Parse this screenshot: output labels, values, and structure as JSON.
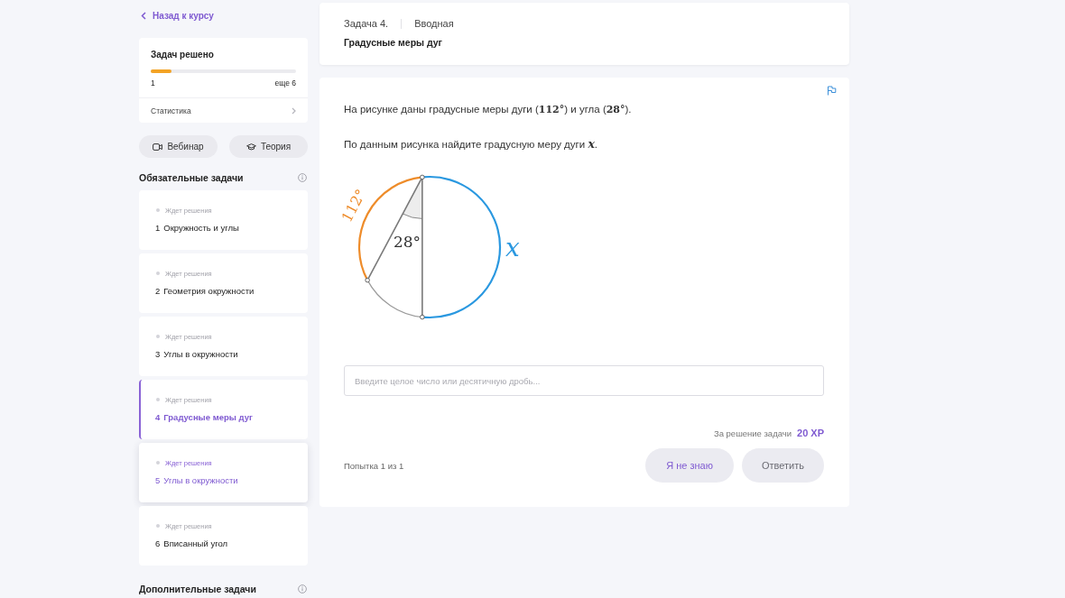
{
  "sidebar": {
    "back_link": "Назад к курсу",
    "progress": {
      "title": "Задач решено",
      "level": 0.14,
      "solved": "1",
      "remaining": "еще 6",
      "stats_link": "Статистика"
    },
    "resource_buttons": [
      {
        "kind": "video",
        "label": "Вебинар"
      },
      {
        "kind": "theory",
        "label": "Теория"
      }
    ],
    "required_tasks": {
      "title": "Обязательные задачи",
      "items": [
        {
          "status": "Ждет решения",
          "number": "1",
          "title": "Окружность и углы",
          "selected": false,
          "hovered": false
        },
        {
          "status": "Ждет решения",
          "number": "2",
          "title": "Геометрия окружности",
          "selected": false,
          "hovered": false
        },
        {
          "status": "Ждет решения",
          "number": "3",
          "title": "Углы в окружности",
          "selected": false,
          "hovered": false
        },
        {
          "status": "Ждет решения",
          "number": "4",
          "title": "Градусные меры дуг",
          "selected": true,
          "hovered": false
        },
        {
          "status": "Ждет решения",
          "number": "5",
          "title": "Углы в окружности",
          "selected": false,
          "hovered": true
        },
        {
          "status": "Ждет решения",
          "number": "6",
          "title": "Вписанный угол",
          "selected": false,
          "hovered": false
        }
      ]
    },
    "extra_tasks": {
      "title": "Дополнительные задачи"
    }
  },
  "task_header": {
    "number": "Задача 4.",
    "type": "Вводная",
    "title": "Градусные меры дуг"
  },
  "problem": {
    "paragraphs": [
      "На рисунке даны градусные меры дуги (**112°**) и угла (**28°**).",
      "По данным рисунка найдите градусную меру дуги *x*."
    ],
    "figure": {
      "arcs": [
        {
          "label": "112°",
          "color": "#ee8c2a"
        },
        {
          "label": "x",
          "color": "#2a98e0"
        }
      ],
      "angle_label": "28°"
    }
  },
  "answer": {
    "placeholder": "Введите целое число или десятичную дробь...",
    "reward_label": "За решение задачи",
    "reward": "20 XP",
    "attempts": "Попытка 1 из 1",
    "buttons": [
      {
        "label": "Я не знаю",
        "disabled": false
      },
      {
        "label": "Ответить",
        "disabled": true
      }
    ]
  }
}
